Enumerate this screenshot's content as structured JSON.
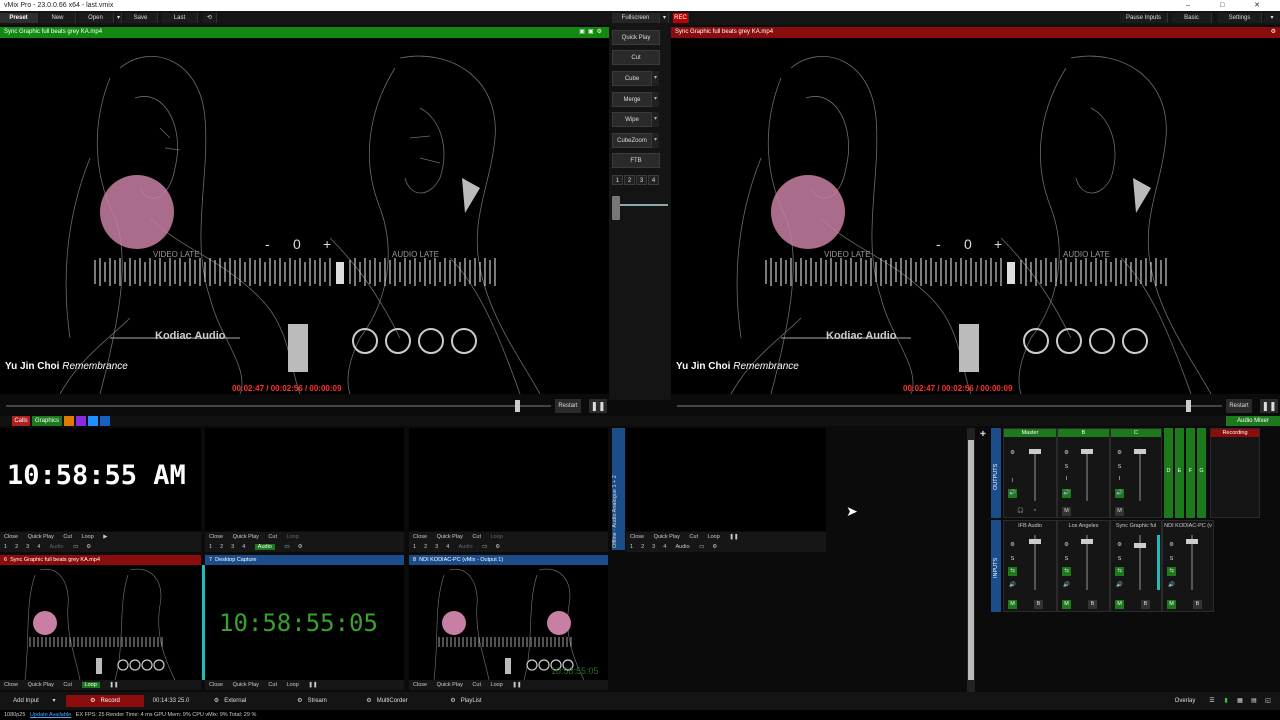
{
  "window": {
    "title": "vMix Pro - 23.0.0.66 x64 - last.vmix",
    "controls": [
      "–",
      "□",
      "✕"
    ]
  },
  "topbar": {
    "preset": "Preset",
    "new": "New",
    "open": "Open",
    "save": "Save",
    "last": "Last",
    "fullscreen": "Fullscreen",
    "rec": "REC",
    "pause_inputs": "Pause Inputs",
    "basic": "Basic",
    "settings": "Settings"
  },
  "preview": {
    "title": "Sync Graphic full beats grey KA.mp4",
    "artist": "Yu Jin Choi",
    "track": "Remembrance",
    "brand": "Kodiac Audio",
    "video_late": "VIDEO LATE",
    "audio_late": "AUDIO LATE",
    "minus": "-",
    "zero": "0",
    "plus": "+",
    "timecode": "00:02:47 / 00:02:56 / 00:00:09",
    "restart": "Restart"
  },
  "output": {
    "title": "Sync Graphic full beats grey KA.mp4",
    "artist": "Yu Jin Choi",
    "track": "Remembrance",
    "brand": "Kodiac Audio",
    "video_late": "VIDEO LATE",
    "audio_late": "AUDIO LATE",
    "minus": "-",
    "zero": "0",
    "plus": "+",
    "timecode": "00:02:47 / 00:02:56 / 00:00:09",
    "restart": "Restart"
  },
  "transitions": {
    "quick_play": "Quick Play",
    "cut": "Cut",
    "cube": "Cube",
    "merge": "Merge",
    "wipe": "Wipe",
    "cubezoom": "CubeZoom",
    "ftb": "FTB",
    "numbers": [
      "1",
      "2",
      "3",
      "4"
    ]
  },
  "tabs": {
    "calls": "Calls",
    "graphics": "Graphics",
    "colors": [
      "#e07b00",
      "#8a2be2",
      "#1e90ff",
      "#1560c0"
    ]
  },
  "inputs": [
    {
      "clock": "10:58:55 AM"
    },
    {
      "num": "6",
      "name": "Sync Graphic full beats grey KA.mp4"
    },
    {
      "num": "7",
      "name": "Desktop Capture",
      "clock": "10:58:55:05"
    },
    {
      "num": "8",
      "name": "NDI KODIAC-PC (vMix - Output 1)",
      "clock": "10:58:55:05"
    }
  ],
  "tile_controls": {
    "close": "Close",
    "quick_play": "Quick Play",
    "cut": "Cut",
    "loop": "Loop",
    "audio": "Audio",
    "nums": [
      "1",
      "2",
      "3",
      "4"
    ]
  },
  "audio_input_label": "Offline - Audio Analogue 1 + 2",
  "mixer": {
    "audio_mixer": "Audio Mixer",
    "recording": "Recording",
    "outputs_label": "OUTPUTS",
    "inputs_label": "INPUTS",
    "buses": [
      "Master",
      "B",
      "C"
    ],
    "side_buses": [
      "D",
      "E",
      "F",
      "G"
    ],
    "channels": [
      "IFB Audio",
      "Los Angeles",
      "Sync Graphic ful",
      "NDI KODIAC-PC (v"
    ],
    "m": "M",
    "b": "B",
    "s": "S",
    "i": "I"
  },
  "statusbar": {
    "add_input": "Add Input",
    "record": "Record",
    "rec_time": "00:14:33 25.0",
    "external": "External",
    "stream": "Stream",
    "multicorder": "MultiCorder",
    "playlist": "PlayList",
    "overlay": "Overlay"
  },
  "infobar": {
    "res": "1080p25",
    "update": "Update Available",
    "stats": "EX  FPS: 25  Render Time: 4 ms  GPU Mem: 9%  CPU vMix: 9%  Total: 29 %"
  }
}
